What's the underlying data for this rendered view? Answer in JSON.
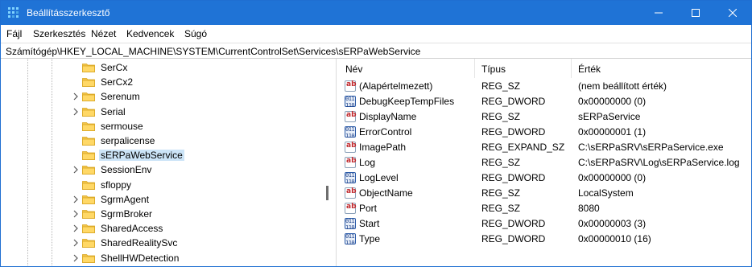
{
  "window": {
    "title": "Beállításszerkesztő",
    "accent": "#1f73d6",
    "controls": {
      "minimize_icon": "minimize-icon",
      "maximize_icon": "maximize-icon",
      "close_icon": "close-icon"
    }
  },
  "menu": [
    "Fájl",
    "Szerkesztés",
    "Nézet",
    "Kedvencek",
    "Súgó"
  ],
  "address": "Számítógép\\HKEY_LOCAL_MACHINE\\SYSTEM\\CurrentControlSet\\Services\\sERPaWebService",
  "tree": {
    "items": [
      {
        "label": "SerCx",
        "expandable": false,
        "selected": false
      },
      {
        "label": "SerCx2",
        "expandable": false,
        "selected": false
      },
      {
        "label": "Serenum",
        "expandable": true,
        "selected": false
      },
      {
        "label": "Serial",
        "expandable": true,
        "selected": false
      },
      {
        "label": "sermouse",
        "expandable": false,
        "selected": false
      },
      {
        "label": "serpalicense",
        "expandable": false,
        "selected": false
      },
      {
        "label": "sERPaWebService",
        "expandable": false,
        "selected": true
      },
      {
        "label": "SessionEnv",
        "expandable": true,
        "selected": false
      },
      {
        "label": "sfloppy",
        "expandable": false,
        "selected": false
      },
      {
        "label": "SgrmAgent",
        "expandable": true,
        "selected": false
      },
      {
        "label": "SgrmBroker",
        "expandable": true,
        "selected": false
      },
      {
        "label": "SharedAccess",
        "expandable": true,
        "selected": false
      },
      {
        "label": "SharedRealitySvc",
        "expandable": true,
        "selected": false
      },
      {
        "label": "ShellHWDetection",
        "expandable": true,
        "selected": false
      }
    ]
  },
  "values": {
    "columns": {
      "name": "Név",
      "type": "Típus",
      "data": "Érték"
    },
    "rows": [
      {
        "name": "(Alapértelmezett)",
        "type": "REG_SZ",
        "data": "(nem beállított érték)",
        "icon": "string-value-icon"
      },
      {
        "name": "DebugKeepTempFiles",
        "type": "REG_DWORD",
        "data": "0x00000000 (0)",
        "icon": "dword-value-icon"
      },
      {
        "name": "DisplayName",
        "type": "REG_SZ",
        "data": "sERPaService",
        "icon": "string-value-icon"
      },
      {
        "name": "ErrorControl",
        "type": "REG_DWORD",
        "data": "0x00000001 (1)",
        "icon": "dword-value-icon"
      },
      {
        "name": "ImagePath",
        "type": "REG_EXPAND_SZ",
        "data": "C:\\sERPaSRV\\sERPaService.exe",
        "icon": "string-value-icon"
      },
      {
        "name": "Log",
        "type": "REG_SZ",
        "data": "C:\\sERPaSRV\\Log\\sERPaService.log",
        "icon": "string-value-icon"
      },
      {
        "name": "LogLevel",
        "type": "REG_DWORD",
        "data": "0x00000000 (0)",
        "icon": "dword-value-icon"
      },
      {
        "name": "ObjectName",
        "type": "REG_SZ",
        "data": "LocalSystem",
        "icon": "string-value-icon"
      },
      {
        "name": "Port",
        "type": "REG_SZ",
        "data": "8080",
        "icon": "string-value-icon"
      },
      {
        "name": "Start",
        "type": "REG_DWORD",
        "data": "0x00000003 (3)",
        "icon": "dword-value-icon"
      },
      {
        "name": "Type",
        "type": "REG_DWORD",
        "data": "0x00000010 (16)",
        "icon": "dword-value-icon"
      }
    ]
  }
}
